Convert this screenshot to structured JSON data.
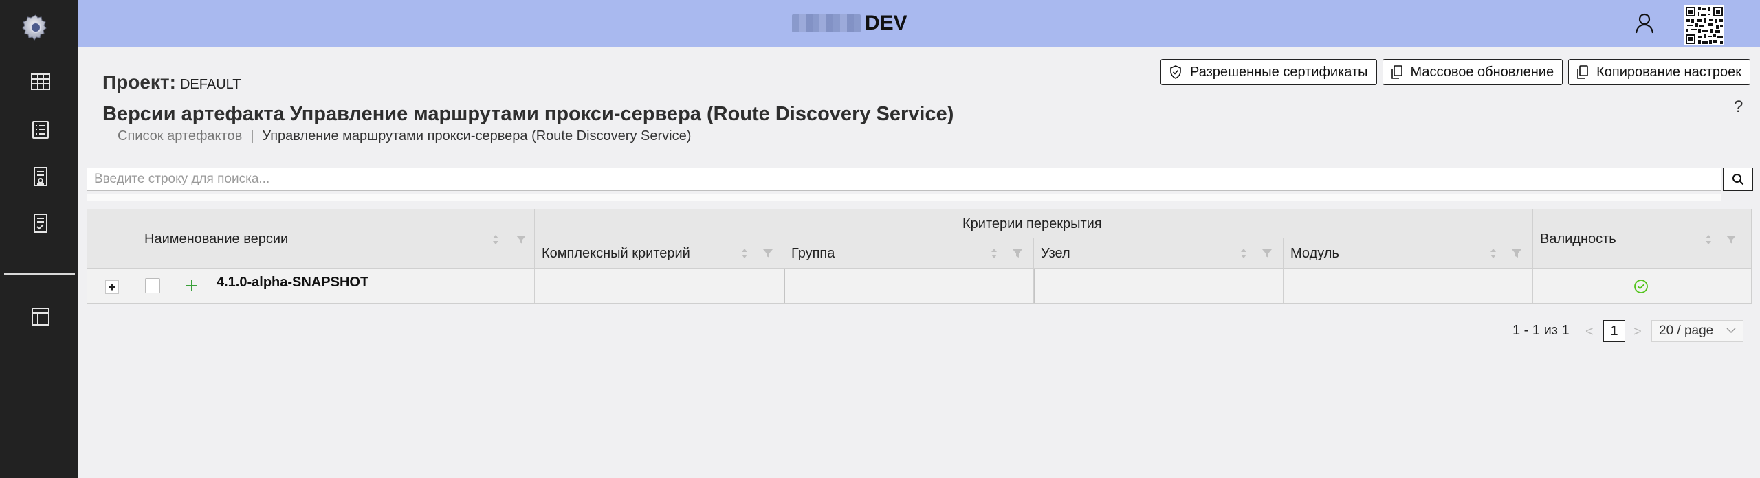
{
  "topbar": {
    "env_label": "DEV"
  },
  "sidebar": {
    "items": [
      {
        "icon": "gear-logo-icon"
      },
      {
        "icon": "table-icon"
      },
      {
        "icon": "list-icon"
      },
      {
        "icon": "certificate-doc-icon"
      },
      {
        "icon": "checklist-doc-icon"
      },
      {
        "icon": "layout-icon"
      }
    ]
  },
  "header": {
    "project_label": "Проект:",
    "project_value": "DEFAULT",
    "title": "Версии артефакта Управление маршрутами прокси-сервера (Route Discovery Service)",
    "breadcrumb": {
      "root": "Список артефактов",
      "separator": "|",
      "current": "Управление маршрутами прокси-сервера (Route Discovery Service)"
    },
    "help": "?"
  },
  "actions": {
    "allowed_certs": "Разрешенные сертификаты",
    "bulk_update": "Массовое обновление",
    "copy_settings": "Копирование настроек"
  },
  "search": {
    "placeholder": "Введите строку для поиска..."
  },
  "table": {
    "col_name": "Наименование версии",
    "group_overlap": "Критерии перекрытия",
    "col_complex": "Комплексный критерий",
    "col_group": "Группа",
    "col_node": "Узел",
    "col_module": "Модуль",
    "col_validity": "Валидность",
    "rows": [
      {
        "expand": "+",
        "version": "4.1.0-alpha-SNAPSHOT",
        "complex": "",
        "group": "",
        "node": "",
        "module": "",
        "valid": true
      }
    ]
  },
  "pagination": {
    "range": "1 - 1 из 1",
    "current_page": "1",
    "page_size": "20 / page"
  },
  "colors": {
    "topbar": "#a9b9ef",
    "sidebar": "#222222",
    "valid_green": "#52c41a",
    "add_green": "#3aa03a"
  }
}
